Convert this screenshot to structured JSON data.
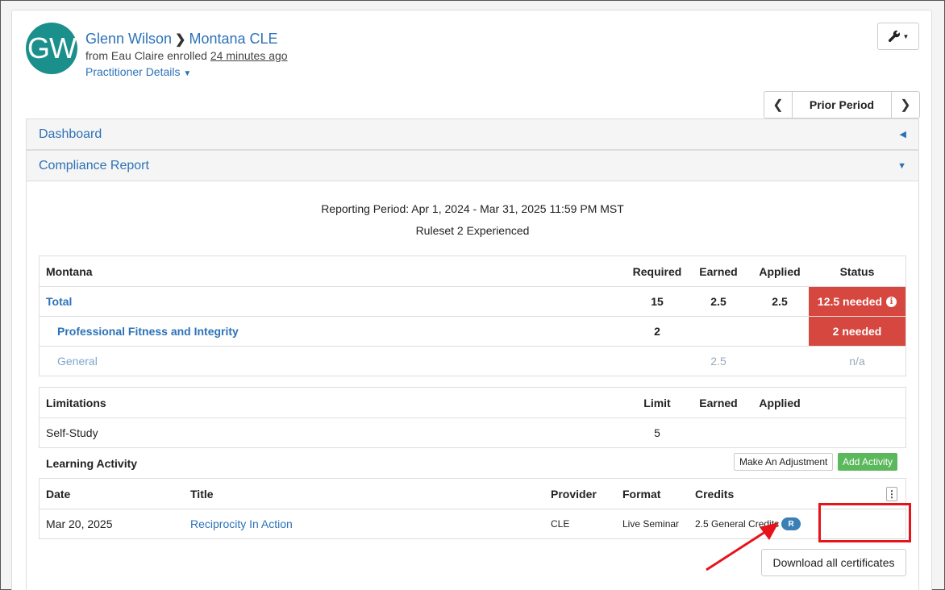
{
  "header": {
    "avatar_initials": "GW",
    "name": "Glenn Wilson",
    "program": "Montana CLE",
    "enrolled_prefix": "from Eau Claire enrolled",
    "enrolled_time": "24 minutes ago",
    "practitioner_details": "Practitioner Details",
    "tool_icon": "wrench-icon"
  },
  "period_nav": {
    "label": "Prior Period"
  },
  "panels": {
    "dashboard": "Dashboard",
    "compliance": "Compliance Report"
  },
  "report": {
    "period": "Reporting Period: Apr 1, 2024 - Mar 31, 2025 11:59 PM MST",
    "ruleset": "Ruleset 2 Experienced"
  },
  "requirements": {
    "headers": {
      "name": "Montana",
      "required": "Required",
      "earned": "Earned",
      "applied": "Applied",
      "status": "Status"
    },
    "rows": [
      {
        "name": "Total",
        "required": "15",
        "earned": "2.5",
        "applied": "2.5",
        "status": "12.5 needed"
      },
      {
        "name": "Professional Fitness and Integrity",
        "required": "2",
        "earned": "",
        "applied": "",
        "status": "2 needed"
      },
      {
        "name": "General",
        "required": "",
        "earned": "2.5",
        "applied": "",
        "status": "n/a"
      }
    ]
  },
  "limitations": {
    "headers": {
      "name": "Limitations",
      "limit": "Limit",
      "earned": "Earned",
      "applied": "Applied"
    },
    "rows": [
      {
        "name": "Self-Study",
        "limit": "5",
        "earned": "",
        "applied": ""
      }
    ]
  },
  "learning_activity": {
    "label": "Learning Activity",
    "adjust_label": "Make An Adjustment",
    "add_label": "Add Activity",
    "headers": {
      "date": "Date",
      "title": "Title",
      "provider": "Provider",
      "format": "Format",
      "credits": "Credits"
    },
    "rows": [
      {
        "date": "Mar 20, 2025",
        "title": "Reciprocity In Action",
        "provider": "CLE",
        "format": "Live Seminar",
        "credits": "2.5 General Credits",
        "badge": "R"
      }
    ],
    "download_label": "Download all certificates"
  },
  "colors": {
    "link": "#2d72b8",
    "status_red": "#d6473f",
    "add_green": "#5cb85c",
    "avatar": "#1b8f8c",
    "annotation_red": "#e8121b"
  }
}
